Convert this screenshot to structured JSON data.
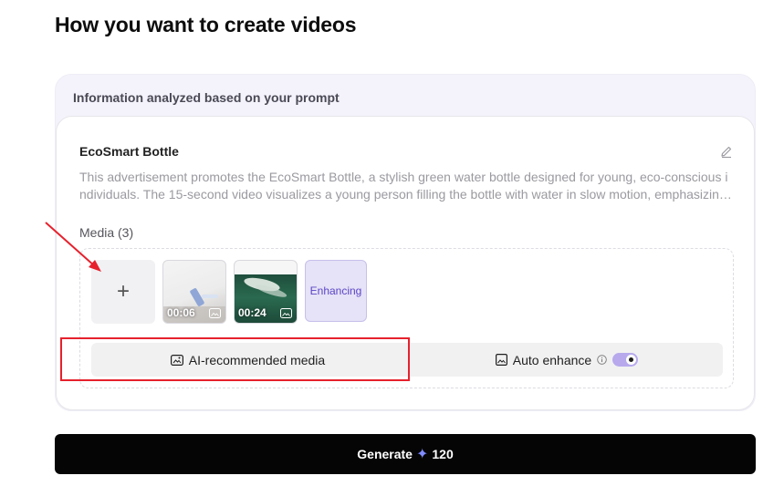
{
  "page": {
    "title": "How you want to create videos"
  },
  "analysis": {
    "header": "Information analyzed based on your prompt",
    "product_title": "EcoSmart Bottle",
    "description": "This advertisement promotes the EcoSmart Bottle, a stylish green water bottle designed for young, eco-conscious individuals. The 15-second video visualizes a young person filling the bottle with water in slow motion, emphasizing..."
  },
  "media": {
    "label": "Media (3)",
    "add_icon": "plus-icon",
    "items": [
      {
        "duration": "00:06",
        "badge_icon": "ai-image-icon"
      },
      {
        "duration": "00:24",
        "badge_icon": "ai-image-icon"
      },
      {
        "status": "Enhancing"
      }
    ],
    "ai_recommended_label": "AI-recommended media",
    "ai_recommended_icon": "ai-image-icon",
    "auto_enhance_label": "Auto enhance",
    "auto_enhance_icon": "image-icon",
    "info_icon": "info-icon",
    "auto_enhance_on": true
  },
  "generate": {
    "label": "Generate",
    "credit_icon": "sparkle-icon",
    "credits": "120"
  },
  "colors": {
    "accent": "#7b61ff",
    "toggle": "#b7a9ec",
    "annotation": "#e6212d",
    "button_bg": "#050505"
  }
}
